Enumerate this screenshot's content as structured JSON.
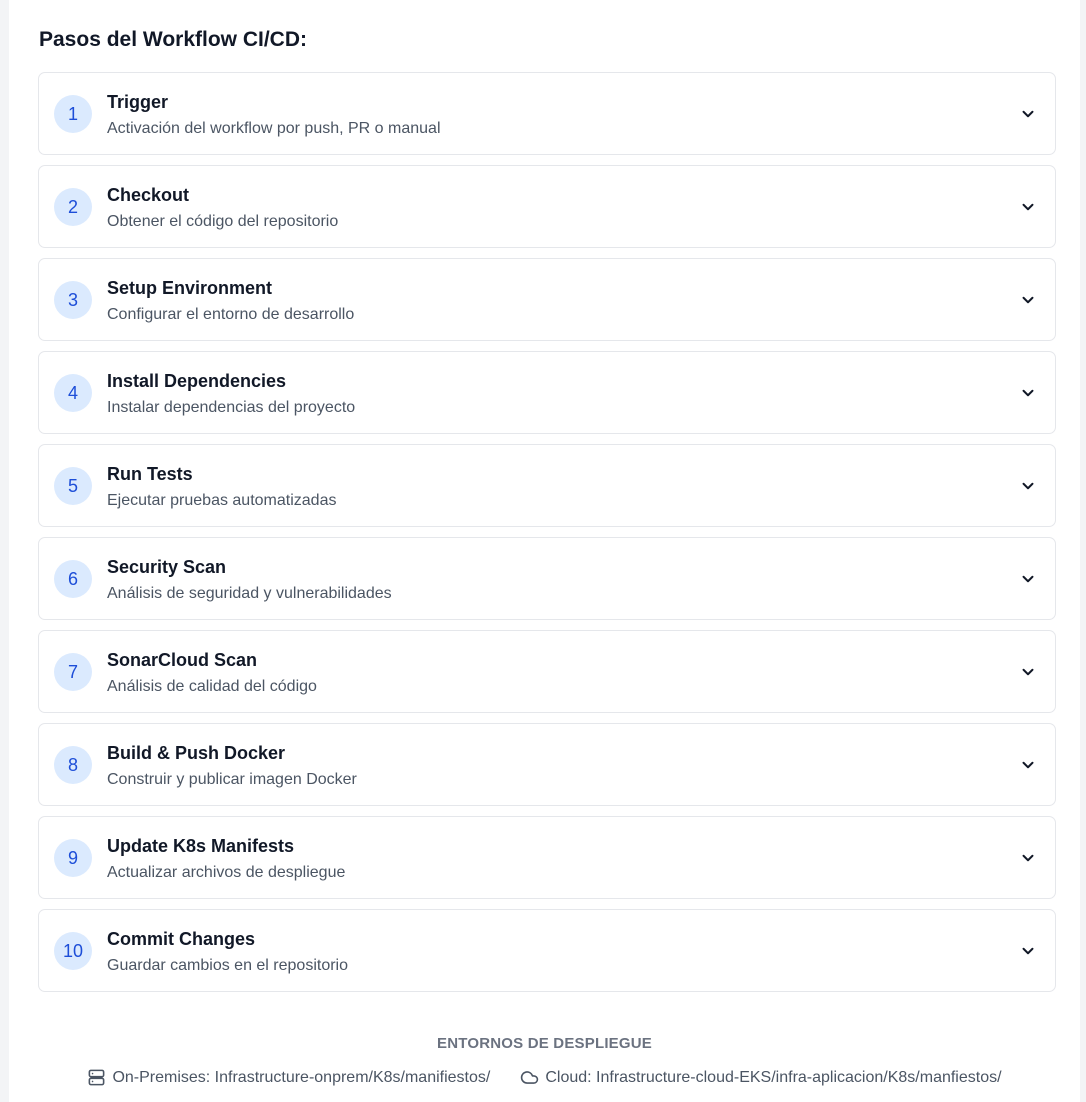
{
  "section": {
    "title": "Pasos del Workflow CI/CD:"
  },
  "icons": {
    "expand": "chevron-down-icon",
    "onprem": "server-icon",
    "cloud": "cloud-icon"
  },
  "colors": {
    "badge_bg": "#dbeafe",
    "badge_text": "#1d4ed8",
    "border": "#e5e7eb"
  },
  "steps": [
    {
      "number": "1",
      "title": "Trigger",
      "description": "Activación del workflow por push, PR o manual"
    },
    {
      "number": "2",
      "title": "Checkout",
      "description": "Obtener el código del repositorio"
    },
    {
      "number": "3",
      "title": "Setup Environment",
      "description": "Configurar el entorno de desarrollo"
    },
    {
      "number": "4",
      "title": "Install Dependencies",
      "description": "Instalar dependencias del proyecto"
    },
    {
      "number": "5",
      "title": "Run Tests",
      "description": "Ejecutar pruebas automatizadas"
    },
    {
      "number": "6",
      "title": "Security Scan",
      "description": "Análisis de seguridad y vulnerabilidades"
    },
    {
      "number": "7",
      "title": "SonarCloud Scan",
      "description": "Análisis de calidad del código"
    },
    {
      "number": "8",
      "title": "Build & Push Docker",
      "description": "Construir y publicar imagen Docker"
    },
    {
      "number": "9",
      "title": "Update K8s Manifests",
      "description": "Actualizar archivos de despliegue"
    },
    {
      "number": "10",
      "title": "Commit Changes",
      "description": "Guardar cambios en el repositorio"
    }
  ],
  "deployment": {
    "title": "ENTORNOS DE DESPLIEGUE",
    "onprem": "On-Premises: Infrastructure-onprem/K8s/manifiestos/",
    "cloud": "Cloud: Infrastructure-cloud-EKS/infra-aplicacion/K8s/manfiestos/"
  }
}
